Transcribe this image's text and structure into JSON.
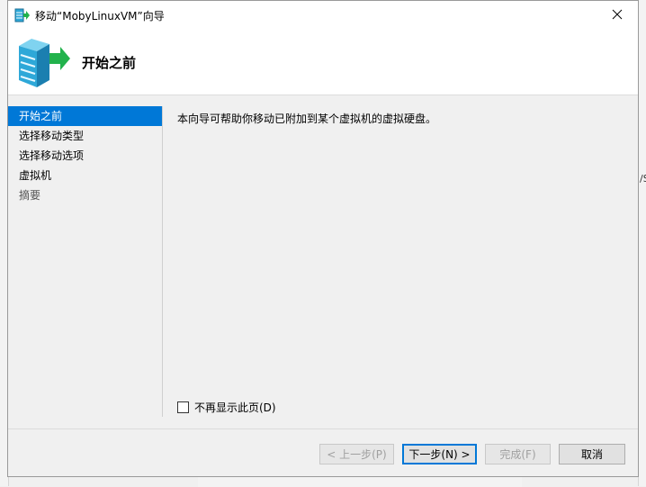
{
  "window": {
    "title": "移动“MobyLinuxVM”向导",
    "close_glyph": "✕"
  },
  "header": {
    "title": "开始之前"
  },
  "nav": {
    "items": [
      {
        "label": "开始之前",
        "state": "active"
      },
      {
        "label": "选择移动类型",
        "state": "normal"
      },
      {
        "label": "选择移动选项",
        "state": "normal"
      },
      {
        "label": "虚拟机",
        "state": "normal"
      },
      {
        "label": "摘要",
        "state": "disabled"
      }
    ]
  },
  "content": {
    "description": "本向导可帮助你移动已附加到某个虚拟机的虚拟硬盘。",
    "dont_show_label": "不再显示此页(D)",
    "dont_show_checked": false
  },
  "buttons": {
    "prev": "< 上一步(P)",
    "next": "下一步(N) >",
    "finish": "完成(F)",
    "cancel": "取消"
  },
  "background": {
    "right_fragment": "/S"
  },
  "colors": {
    "accent": "#0078d7",
    "server_icon": "#2ea8d8",
    "arrow_icon": "#22b24c"
  }
}
